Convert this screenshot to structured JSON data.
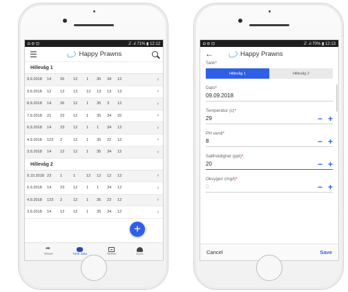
{
  "left_phone": {
    "status": {
      "left": "◘ ⊘ ⊡",
      "right": "ℤ .ıl 71% ▮ 12:12"
    },
    "app_title": "Happy Prawns",
    "groups": [
      {
        "name": "Hillevåg 1",
        "rows": [
          {
            "date": "9.9.2018",
            "v": [
              "14",
              "26",
              "12",
              "1",
              "35",
              "34",
              "12"
            ]
          },
          {
            "date": "9.9.2018",
            "v": [
              "12",
              "12",
              "13",
              "13",
              "13",
              "13",
              "13"
            ]
          },
          {
            "date": "8.9.2018",
            "v": [
              "14",
              "26",
              "12",
              "1",
              "35",
              "3",
              "12"
            ]
          },
          {
            "date": "7.9.2018",
            "v": [
              "21",
              "23",
              "12",
              "1",
              "35",
              "34",
              "32"
            ]
          },
          {
            "date": "6.9.2018",
            "v": [
              "14",
              "23",
              "12",
              "1",
              "1",
              "34",
              "12"
            ]
          },
          {
            "date": "4.9.2018",
            "v": [
              "123",
              "2",
              "12",
              "1",
              "35",
              "22",
              "12"
            ]
          },
          {
            "date": "3.9.2018",
            "v": [
              "14",
              "12",
              "12",
              "1",
              "35",
              "34",
              "12"
            ]
          }
        ]
      },
      {
        "name": "Hillevåg 2",
        "rows": [
          {
            "date": "9.10.2018",
            "v": [
              "23",
              "1",
              "1",
              "12",
              "12",
              "12",
              "12"
            ]
          },
          {
            "date": "6.9.2018",
            "v": [
              "14",
              "23",
              "12",
              "1",
              "1",
              "34",
              "12"
            ]
          },
          {
            "date": "4.9.2018",
            "v": [
              "123",
              "2",
              "12",
              "1",
              "35",
              "22",
              "12"
            ]
          },
          {
            "date": "3.9.2018",
            "v": [
              "14",
              "12",
              "12",
              "1",
              "35",
              "34",
              "12"
            ]
          }
        ]
      }
    ],
    "nav": [
      {
        "label": "Share",
        "icon": "share-icon",
        "active": false
      },
      {
        "label": "Tank data",
        "icon": "database-icon",
        "active": true
      },
      {
        "label": "Tanker",
        "icon": "tank-icon",
        "active": false
      },
      {
        "label": "Sync",
        "icon": "cloud-icon",
        "active": false
      }
    ],
    "fab_label": "+"
  },
  "right_phone": {
    "status": {
      "left": "◘ ⊘ ⊡",
      "right": "ℤ .ıl 70% ▮ 12:13"
    },
    "app_title": "Happy Prawns",
    "tank": {
      "label": "Tank",
      "options": [
        "Hillevåg 1",
        "Hillevåg 2"
      ],
      "selected": "Hillevåg 1"
    },
    "fields": [
      {
        "label": "Dato",
        "value": "09.09.2018",
        "stepper": false,
        "focus": false
      },
      {
        "label": "Temperatur (c)",
        "value": "29",
        "stepper": true,
        "focus": false
      },
      {
        "label": "PH verdi",
        "value": "8",
        "stepper": true,
        "focus": false
      },
      {
        "label": "Saltholdighet (ppt)",
        "value": "20",
        "stepper": true,
        "focus": true
      },
      {
        "label": "Oksygen (mg/l)",
        "value": "0",
        "stepper": true,
        "focus": false,
        "placeholder": true
      }
    ],
    "required_mark": "*",
    "minus": "−",
    "plus": "+",
    "cancel_label": "Cancel",
    "save_label": "Save"
  },
  "colors": {
    "accent": "#2f5fe6",
    "required": "#e0223a"
  }
}
